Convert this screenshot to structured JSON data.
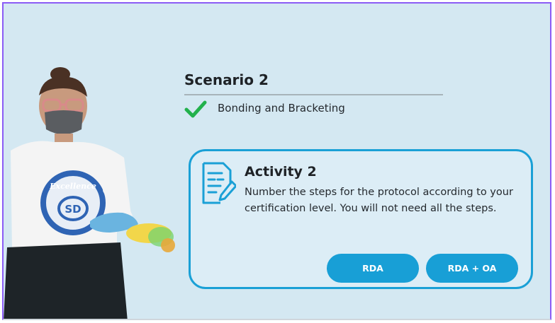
{
  "scenario": {
    "title": "Scenario 2",
    "topic": "Bonding and Bracketing",
    "topic_status_icon": "check-icon"
  },
  "activity": {
    "icon": "document-edit-icon",
    "title": "Activity 2",
    "description": "Number the steps for the protocol according to your certification level. You will not need all the steps."
  },
  "buttons": {
    "rda_label": "RDA",
    "rda_oa_label": "RDA + OA"
  },
  "colors": {
    "background": "#d4e8f2",
    "accent": "#189fd6",
    "check": "#22b14c",
    "frame": "#8b5cf6"
  }
}
